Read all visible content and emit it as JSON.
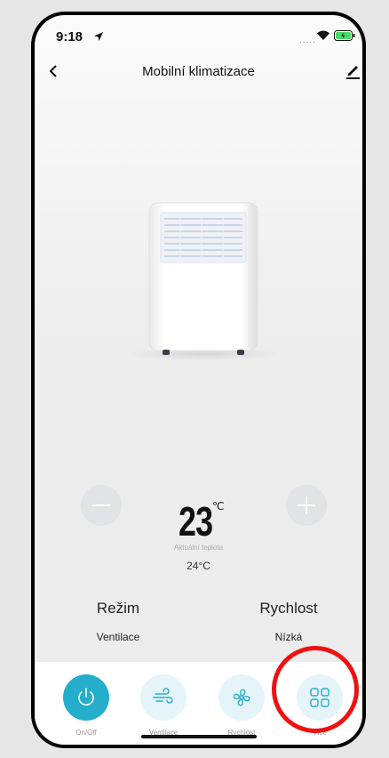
{
  "status_bar": {
    "time": "9:18",
    "signal": "....."
  },
  "header": {
    "title": "Mobilní klimatizace"
  },
  "temperature": {
    "set_value": "23",
    "unit": "℃",
    "current_label": "Aktuální teplota",
    "current_value": "24°C"
  },
  "mode": {
    "label": "Režim",
    "value": "Ventilace"
  },
  "speed": {
    "label": "Rychlost",
    "value": "Nízká"
  },
  "bottom_bar": {
    "onoff_label": "On/Off",
    "ventilation_label": "Ventilace",
    "speed_label": "Rychlost",
    "more_label": "Více"
  },
  "colors": {
    "accent": "#24aecb",
    "accent_light": "#e5f4f8",
    "highlight": "#ee1111"
  }
}
